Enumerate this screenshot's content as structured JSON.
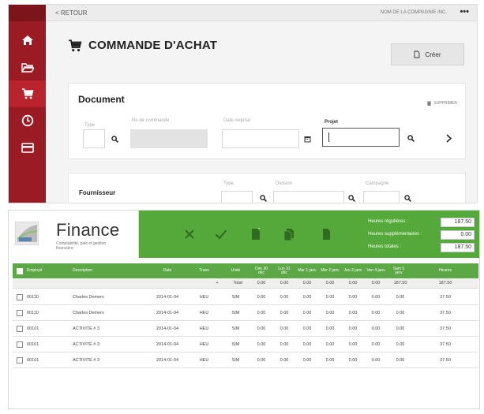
{
  "topbar": {
    "back": "< RETOUR",
    "company": "NOM DE LA COMPAGNIE INC.",
    "menu": "•••"
  },
  "sidebar": {
    "items": [
      {
        "icon": "home-icon",
        "active": false
      },
      {
        "icon": "folder-icon",
        "active": false
      },
      {
        "icon": "cart-icon",
        "active": true
      },
      {
        "icon": "clock-icon",
        "active": false
      },
      {
        "icon": "card-icon",
        "active": false
      }
    ]
  },
  "page": {
    "title": "COMMANDE D'ACHAT",
    "create_label": "Créer"
  },
  "document": {
    "title": "Document",
    "delete_label": "SUPPRIMER",
    "type_label": "Type",
    "order_no_label": "No de commande",
    "date_label": "Date requise",
    "project_label": "Projet"
  },
  "supplier": {
    "title": "Fournisseur",
    "type_label": "Type",
    "division_label": "Division",
    "campaign_label": "Campagne"
  },
  "finance": {
    "brand": "Finance",
    "tagline": "Comptabilité, paie et gestion financière",
    "hours": [
      {
        "label": "Heures régulières :",
        "value": "187.50"
      },
      {
        "label": "Heures supplémentaires :",
        "value": "0.00"
      },
      {
        "label": "Heures totales :",
        "value": "187.50"
      }
    ],
    "columns": [
      "Employé",
      "Description",
      "Date",
      "Trans",
      "Unité",
      "Dim 30 déc",
      "Lun 31 déc",
      "Mar 1 janv",
      "Mer 2 janv",
      "Jeu 3 janv",
      "Ven 4 janv",
      "Sam 5 janv",
      "Heures"
    ],
    "total_row": {
      "plus": "+",
      "label": "Total",
      "values": [
        "0.00",
        "0.00",
        "0.00",
        "0.00",
        "0.00",
        "0.00",
        "187.50",
        "187.50"
      ]
    },
    "rows": [
      {
        "emp": "00110",
        "desc": "Charles Demers",
        "date": "2014-01-04",
        "trans": "HEU",
        "unit": "SIM",
        "d": [
          "0.00",
          "0.00",
          "0.00",
          "0.00",
          "0.00",
          "0.00",
          "0.00",
          "37.50"
        ]
      },
      {
        "emp": "00110",
        "desc": "Charles Demers",
        "date": "2014-01-04",
        "trans": "HEU",
        "unit": "SIM",
        "d": [
          "0.00",
          "0.00",
          "0.00",
          "0.00",
          "0.00",
          "0.00",
          "0.00",
          "37.50"
        ]
      },
      {
        "emp": "00101",
        "desc": "ACTIVITÉ # 3",
        "date": "2014-01-04",
        "trans": "HEU",
        "unit": "SIM",
        "d": [
          "0.00",
          "0.00",
          "0.00",
          "0.00",
          "0.00",
          "0.00",
          "0.00",
          "37.50"
        ]
      },
      {
        "emp": "00101",
        "desc": "ACTIVITÉ # 3",
        "date": "2014-01-04",
        "trans": "HEU",
        "unit": "SIM",
        "d": [
          "0.00",
          "0.00",
          "0.00",
          "0.00",
          "0.00",
          "0.00",
          "0.00",
          "37.50"
        ]
      },
      {
        "emp": "00101",
        "desc": "ACTIVITÉ # 3",
        "date": "2014-01-04",
        "trans": "HEU",
        "unit": "SIM",
        "d": [
          "0.00",
          "0.00",
          "0.00",
          "0.00",
          "0.00",
          "0.00",
          "0.00",
          "37.50"
        ]
      }
    ]
  }
}
